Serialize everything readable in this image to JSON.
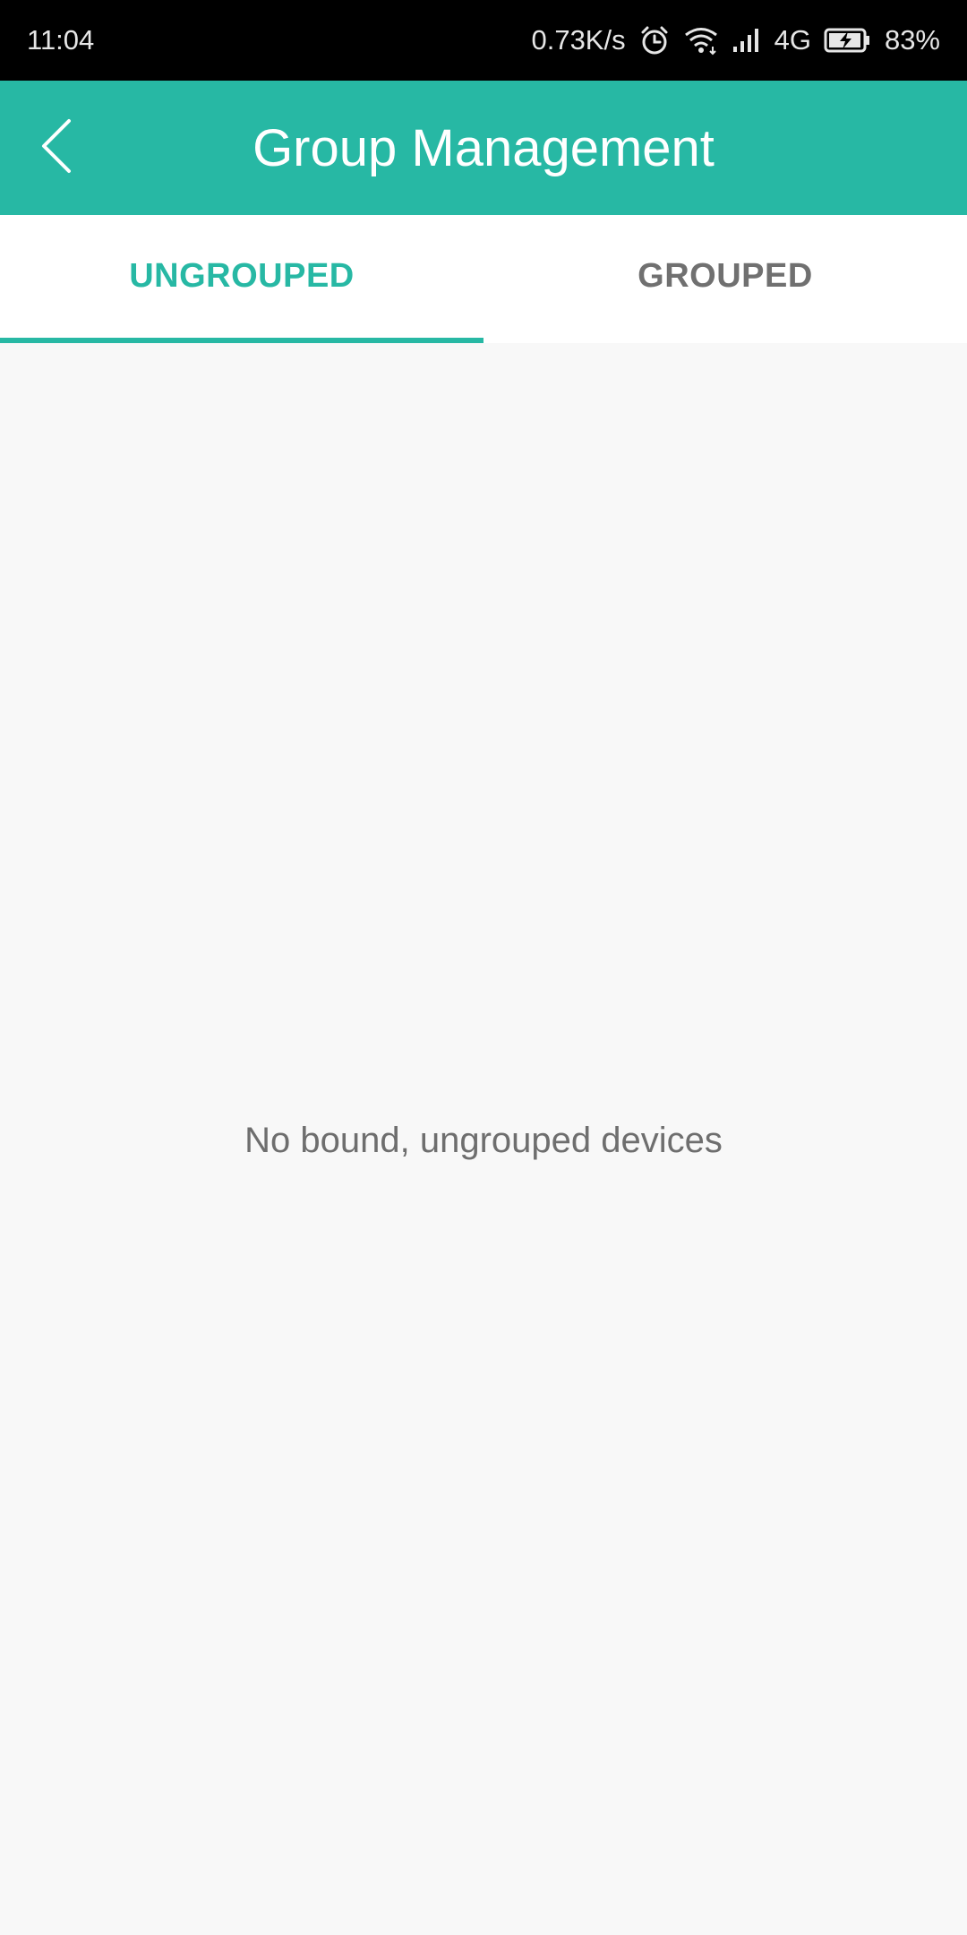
{
  "status_bar": {
    "time": "11:04",
    "network_speed": "0.73K/s",
    "network_type": "4G",
    "battery_percent": "83%",
    "icons": [
      "alarm-icon",
      "wifi-icon",
      "signal-icon",
      "battery-charging-icon"
    ]
  },
  "header": {
    "title": "Group Management",
    "back_icon": "chevron-left-icon"
  },
  "tabs": [
    {
      "label": "UNGROUPED",
      "active": true
    },
    {
      "label": "GROUPED",
      "active": false
    }
  ],
  "main": {
    "empty_message": "No bound, ungrouped devices"
  },
  "colors": {
    "accent": "#27b8a4",
    "status_bar": "#000000",
    "background": "#f8f8f8",
    "inactive_tab": "#707070",
    "message_text": "#6e6e6e"
  }
}
